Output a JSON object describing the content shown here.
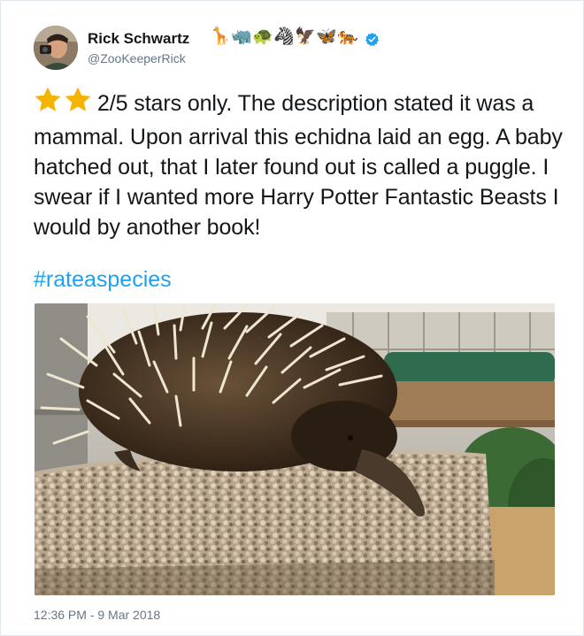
{
  "tweet": {
    "author": {
      "display_name": "Rick Schwartz",
      "handle": "@ZooKeeperRick",
      "avatar": "profile-photo",
      "verified": true,
      "name_emojis": [
        "🦒",
        "🦏",
        "🐢",
        "🦓",
        "🦅",
        "🦋",
        "🐅"
      ]
    },
    "rating": {
      "stars": 2,
      "out_of": 5,
      "star_color": "#f5b400"
    },
    "text": "2/5 stars only. The description stated it was a mammal. Upon arrival this echidna laid an egg. A baby hatched out, that I later found out is called a puggle. I swear if I wanted more Harry Potter Fantastic Beasts I would by another book!",
    "hashtag": "#rateaspecies",
    "media": {
      "type": "photo",
      "subject": "echidna"
    },
    "timestamp": "12:36 PM - 9 Mar 2018"
  },
  "colors": {
    "link": "#1da1f2",
    "secondary_text": "#657786",
    "verified_badge": "#1da1f2",
    "border": "#e1e8ed"
  }
}
